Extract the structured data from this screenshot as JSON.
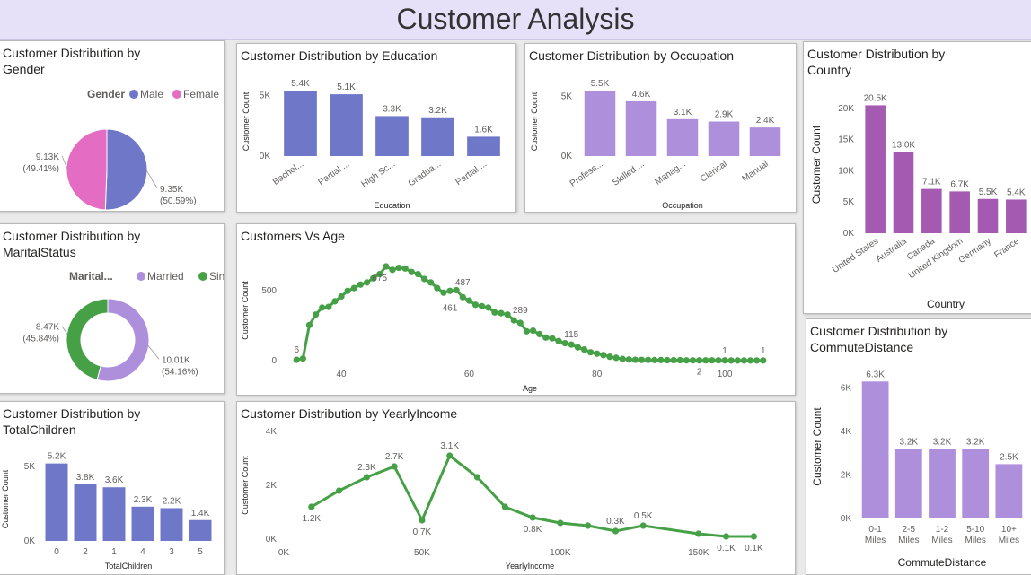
{
  "page": {
    "title": "Customer Analysis"
  },
  "colors": {
    "blue": "#6f77c8",
    "purple": "#ad8fdc",
    "magenta": "#a35ab0",
    "green": "#46a046",
    "pink": "#e46cc3"
  },
  "chart_data": [
    {
      "id": "gender",
      "type": "pie",
      "title": "Customer Distribution by Gender",
      "legend_title": "Gender",
      "labels": [
        "Male",
        "Female"
      ],
      "values": [
        9.35,
        9.13
      ],
      "value_labels": [
        "9.35K",
        "9.13K"
      ],
      "pct_labels": [
        "(50.59%)",
        "(49.41%)"
      ],
      "colors": [
        "#6f77c8",
        "#e46cc3"
      ],
      "legend": "top-right"
    },
    {
      "id": "education",
      "type": "bar",
      "title": "Customer Distribution by Education",
      "xlabel": "Education",
      "ylabel": "Customer Count",
      "categories": [
        "Bachel...",
        "Partial ...",
        "High Sc...",
        "Gradua...",
        "Partial ..."
      ],
      "values": [
        5.4,
        5.1,
        3.3,
        3.2,
        1.6
      ],
      "value_labels": [
        "5.4K",
        "5.1K",
        "3.3K",
        "3.2K",
        "1.6K"
      ],
      "yticks": [
        "0K",
        "5K"
      ],
      "ylim": [
        0,
        5.7
      ],
      "color": "#6f77c8"
    },
    {
      "id": "occupation",
      "type": "bar",
      "title": "Customer Distribution by Occupation",
      "xlabel": "Occupation",
      "ylabel": "Customer Count",
      "categories": [
        "Profess...",
        "Skilled ...",
        "Manag...",
        "Clerical",
        "Manual"
      ],
      "values": [
        5.5,
        4.6,
        3.1,
        2.9,
        2.4
      ],
      "value_labels": [
        "5.5K",
        "4.6K",
        "3.1K",
        "2.9K",
        "2.4K"
      ],
      "yticks": [
        "0K",
        "5K"
      ],
      "ylim": [
        0,
        5.8
      ],
      "color": "#ad8fdc"
    },
    {
      "id": "country",
      "type": "bar",
      "title": "Customer Distribution by Country",
      "xlabel": "Country",
      "ylabel": "Customer Count",
      "categories": [
        "United States",
        "Australia",
        "Canada",
        "United Kingdom",
        "Germany",
        "France"
      ],
      "values": [
        20.5,
        13.0,
        7.1,
        6.7,
        5.5,
        5.4
      ],
      "value_labels": [
        "20.5K",
        "13.0K",
        "7.1K",
        "6.7K",
        "5.5K",
        "5.4K"
      ],
      "yticks": [
        "0K",
        "5K",
        "10K",
        "15K",
        "20K"
      ],
      "ylim": [
        0,
        22
      ],
      "color": "#a35ab0"
    },
    {
      "id": "marital",
      "type": "pie",
      "title": "Customer Distribution by MaritalStatus",
      "legend_title": "Marital...",
      "labels": [
        "Married",
        "Single"
      ],
      "values": [
        10.01,
        8.47
      ],
      "value_labels": [
        "10.01K",
        "8.47K"
      ],
      "pct_labels": [
        "(54.16%)",
        "(45.84%)"
      ],
      "colors": [
        "#ad8fdc",
        "#46a046"
      ],
      "legend": "top-right"
    },
    {
      "id": "age",
      "type": "line",
      "title": "Customers Vs Age",
      "xlabel": "Age",
      "ylabel": "Customer Count",
      "x": [
        33,
        34,
        35,
        36,
        37,
        38,
        39,
        40,
        41,
        42,
        43,
        44,
        45,
        46,
        47,
        48,
        49,
        50,
        51,
        52,
        53,
        54,
        55,
        56,
        57,
        58,
        59,
        60,
        61,
        62,
        63,
        64,
        65,
        66,
        67,
        68,
        69,
        70,
        71,
        72,
        73,
        74,
        75,
        76,
        77,
        78,
        79,
        80,
        81,
        82,
        83,
        84,
        85,
        86,
        87,
        88,
        89,
        90,
        91,
        92,
        93,
        94,
        95,
        96,
        97,
        98,
        99,
        100,
        101,
        102,
        103,
        104,
        105,
        106
      ],
      "y": [
        6,
        15,
        255,
        330,
        380,
        385,
        425,
        460,
        500,
        520,
        545,
        560,
        590,
        620,
        675,
        650,
        665,
        660,
        635,
        620,
        585,
        560,
        520,
        487,
        500,
        505,
        455,
        430,
        400,
        390,
        380,
        345,
        340,
        330,
        289,
        270,
        210,
        215,
        190,
        165,
        160,
        140,
        125,
        115,
        95,
        80,
        60,
        50,
        40,
        28,
        20,
        12,
        8,
        6,
        5,
        5,
        4,
        4,
        3,
        3,
        3,
        2,
        2,
        2,
        2,
        2,
        2,
        2,
        1,
        1,
        1,
        1,
        1,
        1
      ],
      "point_labels": [
        {
          "x": 33,
          "y": 6,
          "text": "6"
        },
        {
          "x": 46,
          "y": 675,
          "text": "675"
        },
        {
          "x": 57,
          "y": 461,
          "text": "461"
        },
        {
          "x": 59,
          "y": 487,
          "text": "487"
        },
        {
          "x": 68,
          "y": 289,
          "text": "289"
        },
        {
          "x": 76,
          "y": 115,
          "text": "115"
        },
        {
          "x": 96,
          "y": 2,
          "text": "2"
        },
        {
          "x": 100,
          "y": 1,
          "text": "1"
        },
        {
          "x": 106,
          "y": 1,
          "text": "1"
        }
      ],
      "xticks": [
        40,
        60,
        80,
        100
      ],
      "yticks": [
        0,
        500
      ],
      "xlim": [
        31,
        108
      ],
      "ylim": [
        0,
        720
      ],
      "color": "#46a046"
    },
    {
      "id": "children",
      "type": "bar",
      "title": "Customer Distribution by TotalChildren",
      "xlabel": "TotalChildren",
      "ylabel": "Customer Count",
      "categories": [
        "0",
        "2",
        "1",
        "4",
        "3",
        "5"
      ],
      "values": [
        5.2,
        3.8,
        3.6,
        2.3,
        2.2,
        1.4
      ],
      "value_labels": [
        "5.2K",
        "3.8K",
        "3.6K",
        "2.3K",
        "2.2K",
        "1.4K"
      ],
      "yticks": [
        "0K",
        "5K"
      ],
      "ylim": [
        0,
        5.6
      ],
      "color": "#6f77c8"
    },
    {
      "id": "income",
      "type": "line",
      "title": "Customer Distribution by YearlyIncome",
      "xlabel": "YearlyIncome",
      "ylabel": "Customer Count",
      "x": [
        10,
        20,
        30,
        40,
        50,
        60,
        70,
        80,
        90,
        100,
        110,
        120,
        130,
        150,
        160,
        170
      ],
      "y": [
        1.2,
        1.8,
        2.3,
        2.7,
        0.7,
        3.1,
        2.3,
        1.2,
        0.8,
        0.6,
        0.5,
        0.3,
        0.5,
        0.2,
        0.1,
        0.1
      ],
      "point_labels": [
        {
          "x": 10,
          "y": 1.2,
          "text": "1.2K"
        },
        {
          "x": 30,
          "y": 2.3,
          "text": "2.3K"
        },
        {
          "x": 40,
          "y": 2.7,
          "text": "2.7K"
        },
        {
          "x": 50,
          "y": 0.7,
          "text": "0.7K"
        },
        {
          "x": 60,
          "y": 3.1,
          "text": "3.1K"
        },
        {
          "x": 90,
          "y": 0.8,
          "text": "0.8K"
        },
        {
          "x": 120,
          "y": 0.3,
          "text": "0.3K"
        },
        {
          "x": 130,
          "y": 0.5,
          "text": "0.5K"
        },
        {
          "x": 160,
          "y": 0.1,
          "text": "0.1K"
        },
        {
          "x": 170,
          "y": 0.1,
          "text": "0.1K"
        }
      ],
      "xticks": [
        "0K",
        "50K",
        "100K",
        "150K"
      ],
      "xtick_values": [
        0,
        50,
        100,
        150
      ],
      "yticks": [
        "0K",
        "2K",
        "4K"
      ],
      "ytick_values": [
        0,
        2,
        4
      ],
      "xlim": [
        0,
        178
      ],
      "ylim": [
        0,
        4
      ],
      "color": "#46a046"
    },
    {
      "id": "commute",
      "type": "bar",
      "title": "Customer Distribution by CommuteDistance",
      "xlabel": "CommuteDistance",
      "ylabel": "Customer Count",
      "categories": [
        [
          "0-1",
          "Miles"
        ],
        [
          "2-5",
          "Miles"
        ],
        [
          "1-2",
          "Miles"
        ],
        [
          "5-10",
          "Miles"
        ],
        [
          "10+",
          "Miles"
        ]
      ],
      "values": [
        6.3,
        3.2,
        3.2,
        3.2,
        2.5
      ],
      "value_labels": [
        "6.3K",
        "3.2K",
        "3.2K",
        "3.2K",
        "2.5K"
      ],
      "yticks": [
        "0K",
        "2K",
        "4K",
        "6K"
      ],
      "ytick_values": [
        0,
        2,
        4,
        6
      ],
      "ylim": [
        0,
        6.6
      ],
      "color": "#ad8fdc"
    }
  ]
}
